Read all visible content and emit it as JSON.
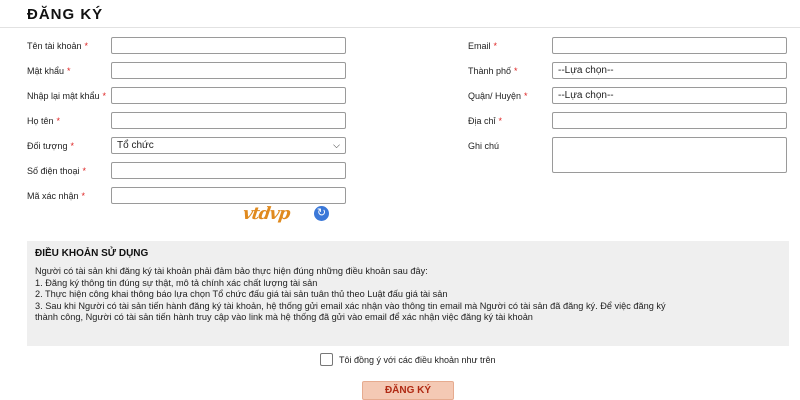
{
  "page": {
    "title": "ĐĂNG KÝ"
  },
  "form": {
    "required_mark": "*",
    "left": {
      "username": {
        "label": "Tên tài khoản",
        "value": ""
      },
      "password": {
        "label": "Mật khẩu",
        "value": ""
      },
      "password_confirm": {
        "label": "Nhập lại mật khẩu",
        "value": ""
      },
      "fullname": {
        "label": "Họ tên",
        "value": ""
      },
      "subject": {
        "label": "Đối tượng",
        "selected": "Tổ chức"
      },
      "phone": {
        "label": "Số điện thoại",
        "value": ""
      },
      "captcha": {
        "label": "Mã xác nhận",
        "value": "",
        "image_text": "vtdvp"
      }
    },
    "right": {
      "email": {
        "label": "Email",
        "value": ""
      },
      "city": {
        "label": "Thành phố",
        "selected": "--Lựa chọn--"
      },
      "district": {
        "label": "Quận/ Huyện",
        "selected": "--Lựa chọn--"
      },
      "address": {
        "label": "Địa chỉ",
        "value": ""
      },
      "note": {
        "label": "Ghi chú",
        "value": ""
      }
    }
  },
  "terms": {
    "title": "ĐIỀU KHOẢN SỬ DỤNG",
    "lines": [
      "Người có tài sản khi đăng ký tài khoản phải đảm bảo thực hiện đúng những điều khoản sau đây:",
      "1. Đăng ký thông tin đúng sự thật, mô tả chính xác chất lượng tài sản",
      "2. Thực hiện công khai thông báo lựa chọn Tổ chức đấu giá tài sản tuân thủ theo Luật đấu giá tài sản",
      "3. Sau khi Người có tài sản tiến hành đăng ký tài khoản, hệ thống gửi email xác nhận vào thông tin email mà Người có tài sản đã đăng ký. Để việc đăng ký",
      "thành công, Người có tài sản tiến hành truy cập vào link mà hệ thống đã gửi vào email để xác nhận việc đăng ký tài khoản"
    ]
  },
  "agree": {
    "label": "Tôi đồng ý với các điều khoản như trên",
    "checked": false
  },
  "submit": {
    "label": "ĐĂNG KÝ"
  },
  "colors": {
    "required": "#dd2222",
    "submit_bg": "#f4c9b4",
    "submit_text": "#b02a13",
    "terms_bg": "#efefef"
  }
}
